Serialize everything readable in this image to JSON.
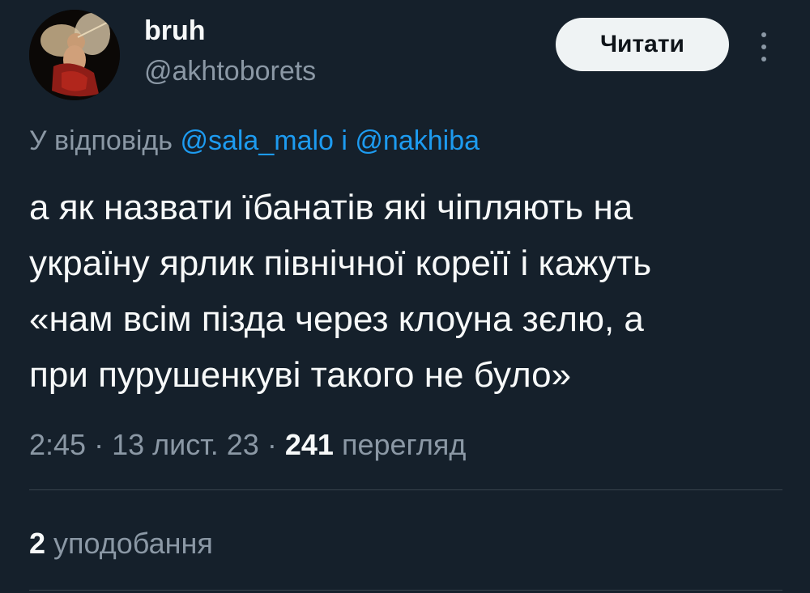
{
  "author": {
    "display_name": "bruh",
    "handle": "@akhtoborets",
    "avatar_icon": "cupid-painting-avatar"
  },
  "follow_button": {
    "label": "Читати"
  },
  "more_icon": "more-vertical-icon",
  "reply": {
    "prefix": "У відповідь",
    "mention_1": "@sala_malo",
    "conjunction": "і",
    "mention_2": "@nakhiba"
  },
  "tweet": {
    "lines": [
      "а як назвати їбанатів які чіпляють на",
      "україну ярлик північної кореїї і кажуть",
      "«нам всім пізда через клоуна зєлю, а",
      "при пурушенкуві такого не було»"
    ]
  },
  "meta": {
    "time": "2:45",
    "separator": "·",
    "date": "13 лист. 23",
    "views_count": "241",
    "views_label": "перегляд"
  },
  "stats": {
    "likes_count": "2",
    "likes_label": "уподобання"
  },
  "colors": {
    "background": "#15202b",
    "primary_text": "#f7f9f9",
    "secondary_text": "#8b98a5",
    "link": "#1d9bf0",
    "button_bg": "#eff3f4",
    "divider": "#38444d"
  }
}
